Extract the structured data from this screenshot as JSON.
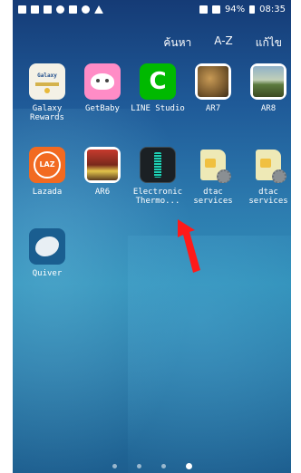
{
  "statusbar": {
    "battery": "94%",
    "time": "08:35"
  },
  "topmenu": {
    "search": "ค้นหา",
    "az": "A-Z",
    "edit": "แก้ไข"
  },
  "apps": [
    {
      "label": "Galaxy Rewards",
      "icon": "galaxy-rewards-icon",
      "brand_text": "Galaxy"
    },
    {
      "label": "GetBaby",
      "icon": "getbaby-icon"
    },
    {
      "label": "LINE Studio",
      "icon": "line-studio-icon",
      "glyph": "C"
    },
    {
      "label": "AR7",
      "icon": "ar7-photo-icon"
    },
    {
      "label": "AR8",
      "icon": "ar8-photo-icon"
    },
    {
      "label": "Lazada",
      "icon": "lazada-icon",
      "glyph": "LAZ"
    },
    {
      "label": "AR6",
      "icon": "ar6-photo-icon"
    },
    {
      "label": "Electronic Thermo...",
      "icon": "electronic-thermometer-icon"
    },
    {
      "label": "dtac services",
      "icon": "dtac-sim-icon"
    },
    {
      "label": "dtac services",
      "icon": "dtac-sim-icon"
    },
    {
      "label": "Quiver",
      "icon": "quiver-icon"
    }
  ],
  "pages": {
    "count": 4,
    "active": 4
  },
  "colors": {
    "accent": "#ff1a1a",
    "line": "#00b900",
    "lazada": "#f26a21"
  }
}
